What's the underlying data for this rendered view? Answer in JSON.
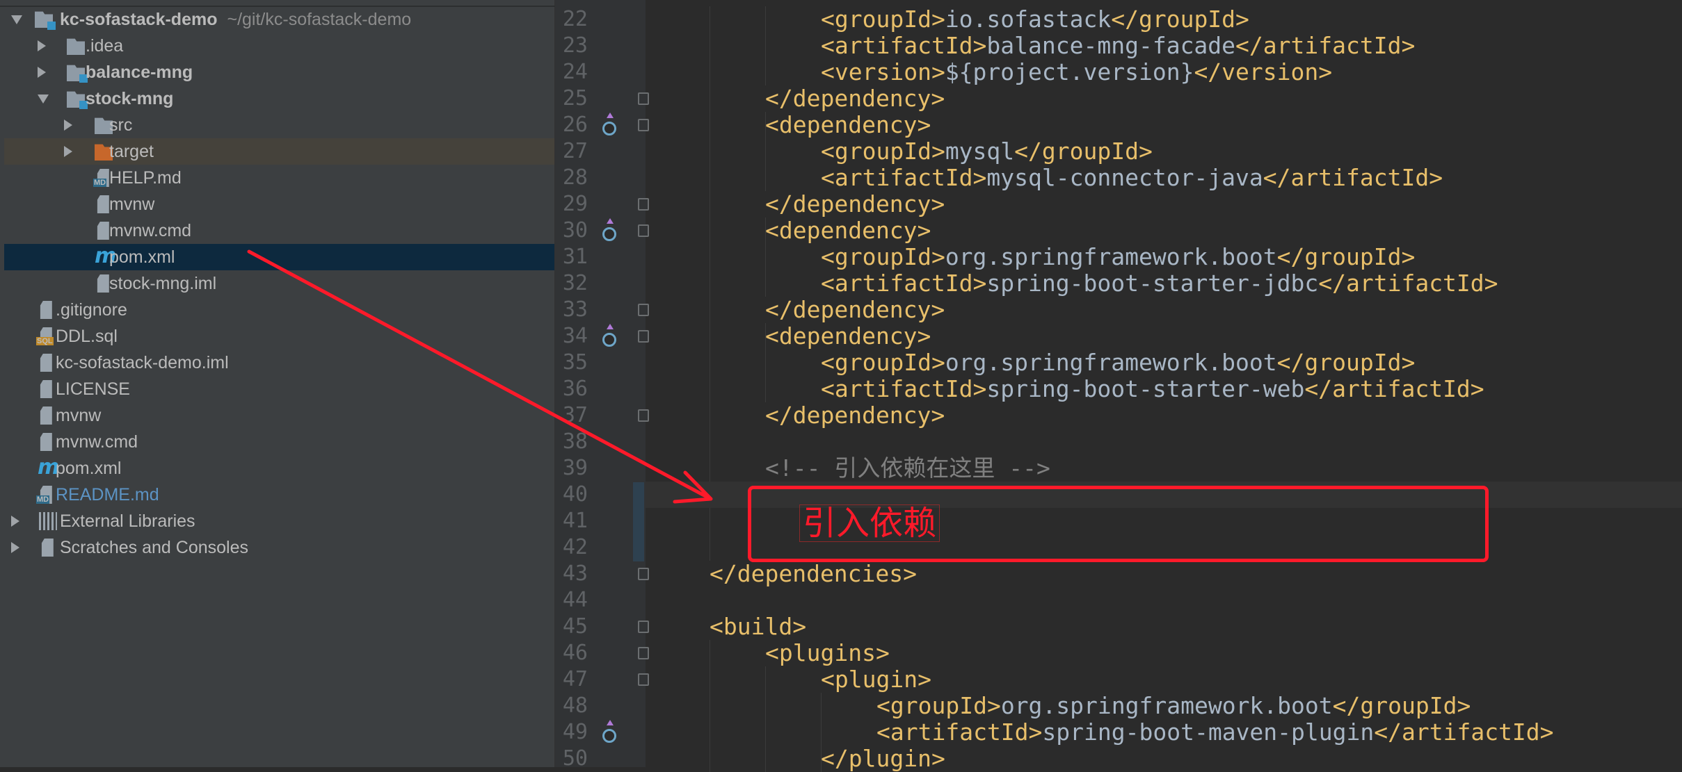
{
  "project_tree": {
    "root": {
      "name": "kc-sofastack-demo",
      "path": "~/git/kc-sofastack-demo"
    },
    "items": [
      {
        "label": ".idea",
        "type": "folder",
        "level": 1,
        "arrow": "collapsed"
      },
      {
        "label": "balance-mng",
        "type": "module",
        "level": 1,
        "arrow": "collapsed"
      },
      {
        "label": "stock-mng",
        "type": "module",
        "level": 1,
        "arrow": "expanded"
      },
      {
        "label": "src",
        "type": "folder",
        "level": 2,
        "arrow": "collapsed"
      },
      {
        "label": "target",
        "type": "excluded-folder",
        "level": 2,
        "arrow": "collapsed"
      },
      {
        "label": "HELP.md",
        "type": "markdown",
        "level": 2
      },
      {
        "label": "mvnw",
        "type": "text",
        "level": 2
      },
      {
        "label": "mvnw.cmd",
        "type": "text",
        "level": 2
      },
      {
        "label": "pom.xml",
        "type": "maven",
        "level": 2,
        "selected": true
      },
      {
        "label": "stock-mng.iml",
        "type": "iml",
        "level": 2
      },
      {
        "label": ".gitignore",
        "type": "text",
        "level": 1
      },
      {
        "label": "DDL.sql",
        "type": "sql",
        "level": 1
      },
      {
        "label": "kc-sofastack-demo.iml",
        "type": "iml",
        "level": 1
      },
      {
        "label": "LICENSE",
        "type": "text",
        "level": 1
      },
      {
        "label": "mvnw",
        "type": "text",
        "level": 1
      },
      {
        "label": "mvnw.cmd",
        "type": "text",
        "level": 1
      },
      {
        "label": "pom.xml",
        "type": "maven",
        "level": 1
      },
      {
        "label": "README.md",
        "type": "markdown",
        "level": 1,
        "color": "#5c93c4"
      },
      {
        "label": "External Libraries",
        "type": "libraries",
        "level": 0,
        "arrow": "collapsed"
      },
      {
        "label": "Scratches and Consoles",
        "type": "scratches",
        "level": 0,
        "arrow": "collapsed"
      }
    ]
  },
  "editor": {
    "current_line": 40,
    "lines": [
      {
        "n": "22",
        "indent": 12,
        "text": "<groupId>io.sofastack</groupId>"
      },
      {
        "n": "23",
        "indent": 12,
        "text": "<artifactId>balance-mng-facade</artifactId>"
      },
      {
        "n": "24",
        "indent": 12,
        "text": "<version>${project.version}</version>"
      },
      {
        "n": "25",
        "indent": 8,
        "text": "</dependency>"
      },
      {
        "n": "26",
        "indent": 8,
        "text": "<dependency>"
      },
      {
        "n": "27",
        "indent": 12,
        "text": "<groupId>mysql</groupId>"
      },
      {
        "n": "28",
        "indent": 12,
        "text": "<artifactId>mysql-connector-java</artifactId>"
      },
      {
        "n": "29",
        "indent": 8,
        "text": "</dependency>"
      },
      {
        "n": "30",
        "indent": 8,
        "text": "<dependency>"
      },
      {
        "n": "31",
        "indent": 12,
        "text": "<groupId>org.springframework.boot</groupId>"
      },
      {
        "n": "32",
        "indent": 12,
        "text": "<artifactId>spring-boot-starter-jdbc</artifactId>"
      },
      {
        "n": "33",
        "indent": 8,
        "text": "</dependency>"
      },
      {
        "n": "34",
        "indent": 8,
        "text": "<dependency>"
      },
      {
        "n": "35",
        "indent": 12,
        "text": "<groupId>org.springframework.boot</groupId>"
      },
      {
        "n": "36",
        "indent": 12,
        "text": "<artifactId>spring-boot-starter-web</artifactId>"
      },
      {
        "n": "37",
        "indent": 8,
        "text": "</dependency>"
      },
      {
        "n": "38",
        "indent": 0,
        "text": ""
      },
      {
        "n": "39",
        "indent": 8,
        "text": "<!-- 引入依赖在这里 -->",
        "comment": true
      },
      {
        "n": "40",
        "indent": 0,
        "text": ""
      },
      {
        "n": "41",
        "indent": 0,
        "text": ""
      },
      {
        "n": "42",
        "indent": 0,
        "text": ""
      },
      {
        "n": "43",
        "indent": 4,
        "text": "</dependencies>"
      },
      {
        "n": "44",
        "indent": 0,
        "text": ""
      },
      {
        "n": "45",
        "indent": 4,
        "text": "<build>"
      },
      {
        "n": "46",
        "indent": 8,
        "text": "<plugins>"
      },
      {
        "n": "47",
        "indent": 12,
        "text": "<plugin>"
      },
      {
        "n": "48",
        "indent": 16,
        "text": "<groupId>org.springframework.boot</groupId>"
      },
      {
        "n": "49",
        "indent": 16,
        "text": "<artifactId>spring-boot-maven-plugin</artifactId>"
      },
      {
        "n": "50",
        "indent": 12,
        "text": "</plugin>"
      }
    ],
    "fold_lines": [
      "25",
      "26",
      "29",
      "30",
      "33",
      "34",
      "37",
      "43",
      "45",
      "46",
      "47"
    ],
    "maven_gutter_lines": [
      "26",
      "30",
      "34",
      "49"
    ]
  },
  "annotation": {
    "label": "引入依赖",
    "color": "#ff1a2a"
  }
}
